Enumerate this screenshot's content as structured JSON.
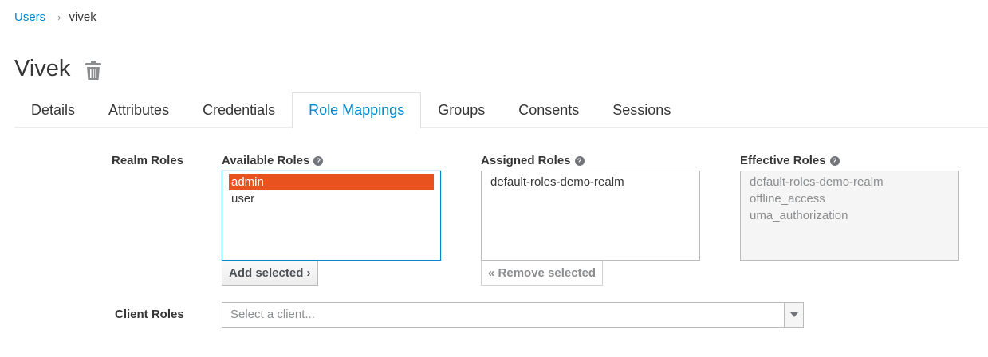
{
  "breadcrumb": {
    "parent": "Users",
    "separator": "›",
    "current": "vivek"
  },
  "page": {
    "title": "Vivek"
  },
  "tabs": [
    {
      "label": "Details"
    },
    {
      "label": "Attributes"
    },
    {
      "label": "Credentials"
    },
    {
      "label": "Role Mappings",
      "active": true
    },
    {
      "label": "Groups"
    },
    {
      "label": "Consents"
    },
    {
      "label": "Sessions"
    }
  ],
  "realm_roles": {
    "label": "Realm Roles",
    "available": {
      "label": "Available Roles",
      "help": "?",
      "items": [
        "admin",
        "user"
      ],
      "selected": "admin"
    },
    "assigned": {
      "label": "Assigned Roles",
      "help": "?",
      "items": [
        "default-roles-demo-realm"
      ]
    },
    "effective": {
      "label": "Effective Roles",
      "help": "?",
      "items": [
        "default-roles-demo-realm",
        "offline_access",
        "uma_authorization"
      ]
    },
    "add_button": "Add selected",
    "add_icon": "›",
    "remove_button": "Remove selected",
    "remove_icon": "«"
  },
  "client_roles": {
    "label": "Client Roles",
    "placeholder": "Select a client..."
  },
  "colors": {
    "accent": "#0088ce",
    "selected_option": "#e8521f"
  },
  "icons": {
    "trash": "trash-icon",
    "help": "help-circle-icon",
    "dropdown": "caret-down-icon"
  }
}
